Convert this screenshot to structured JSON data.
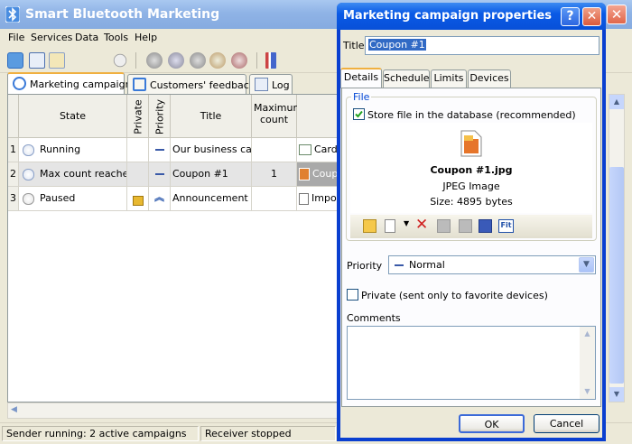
{
  "app": {
    "title": "Smart Bluetooth Marketing"
  },
  "menu": [
    "File",
    "Services",
    "Data",
    "Tools",
    "Help"
  ],
  "main_tabs": [
    {
      "label": "Marketing campaigns",
      "active": true
    },
    {
      "label": "Customers' feedback",
      "active": false
    },
    {
      "label": "Log",
      "active": false
    }
  ],
  "grid": {
    "columns": {
      "state": "State",
      "private": "Private",
      "priority": "Priority",
      "title": "Title",
      "max_count": "Maximum count"
    },
    "rows": [
      {
        "num": "1",
        "state": "Running",
        "private": false,
        "priority": "normal",
        "title": "Our business card",
        "max_count": "",
        "file": "Card"
      },
      {
        "num": "2",
        "state": "Max count reached",
        "private": false,
        "priority": "normal",
        "title": "Coupon #1",
        "max_count": "1",
        "file": "Coupo"
      },
      {
        "num": "3",
        "state": "Paused",
        "private": true,
        "priority": "highest",
        "title": "Announcement",
        "max_count": "",
        "file": "Impo"
      }
    ]
  },
  "status": {
    "sender": "Sender running: 2 active campaigns",
    "receiver": "Receiver stopped"
  },
  "dialog": {
    "title": "Marketing campaign properties",
    "help_glyph": "?",
    "title_label": "Title",
    "title_value": "Coupon #1",
    "tabs": [
      "Details",
      "Schedule",
      "Limits",
      "Devices"
    ],
    "active_tab": "Details",
    "file_group_label": "File",
    "store_checkbox": {
      "label": "Store file in the database (recommended)",
      "checked": true
    },
    "file": {
      "name": "Coupon #1.jpg",
      "type": "JPEG Image",
      "size": "Size: 4895 bytes"
    },
    "priority_label": "Priority",
    "priority_value": "Normal",
    "private_checkbox": {
      "label": "Private (sent only to favorite devices)",
      "checked": false
    },
    "comments_label": "Comments",
    "comments_value": "",
    "ok_label": "OK",
    "cancel_label": "Cancel"
  },
  "colors": {
    "dialog_titlebar": "#0a5ae6",
    "main_titlebar": "#8fb3e6",
    "selection": "#316ac5",
    "tab_highlight": "#f0b040"
  }
}
